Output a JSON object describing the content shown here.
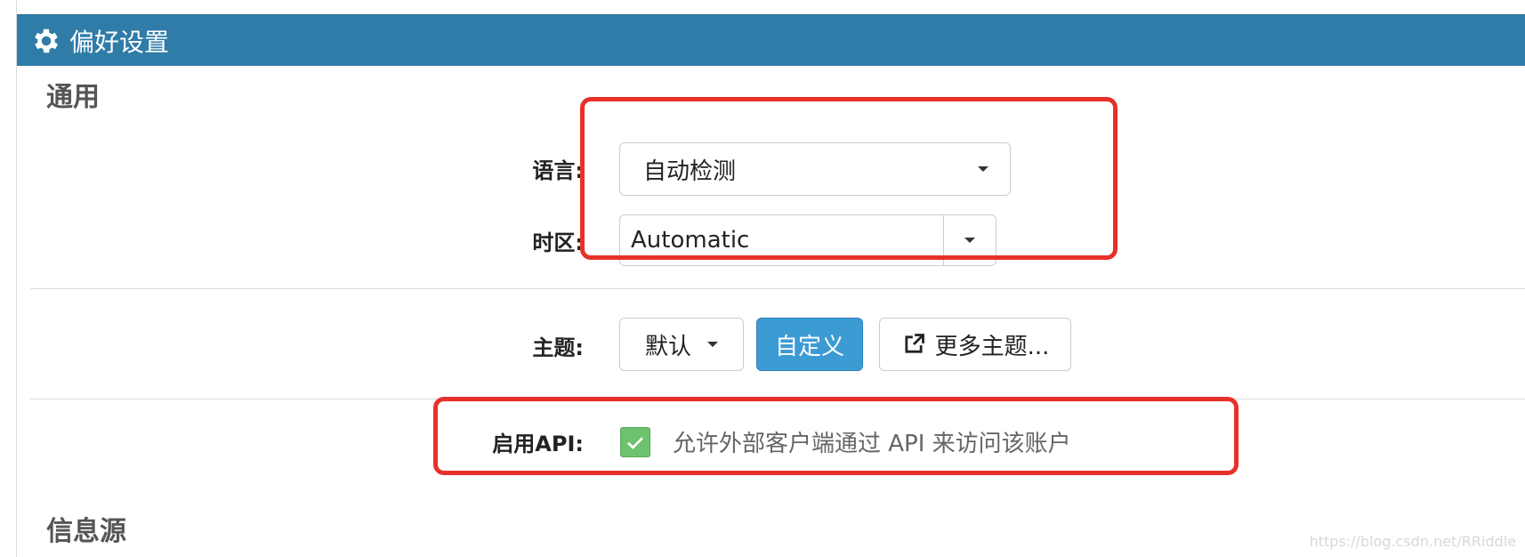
{
  "header": {
    "title": "偏好设置",
    "icon": "gear-icon"
  },
  "general": {
    "section_title": "通用",
    "language": {
      "label": "语言:",
      "value": "自动检测"
    },
    "timezone": {
      "label": "时区:",
      "value": "Automatic"
    },
    "theme": {
      "label": "主题:",
      "default_label": "默认",
      "custom_label": "自定义",
      "more_label": "更多主题..."
    },
    "api": {
      "label": "启用API:",
      "checked": true,
      "description": "允许外部客户端通过 API 来访问该账户"
    }
  },
  "feeds": {
    "section_title": "信息源"
  },
  "watermark": "https://blog.csdn.net/RRiddle",
  "colors": {
    "header_bg": "#2f7ca8",
    "primary_button": "#3d9bd4",
    "checkbox": "#6cc26e",
    "highlight": "#e8302a"
  }
}
